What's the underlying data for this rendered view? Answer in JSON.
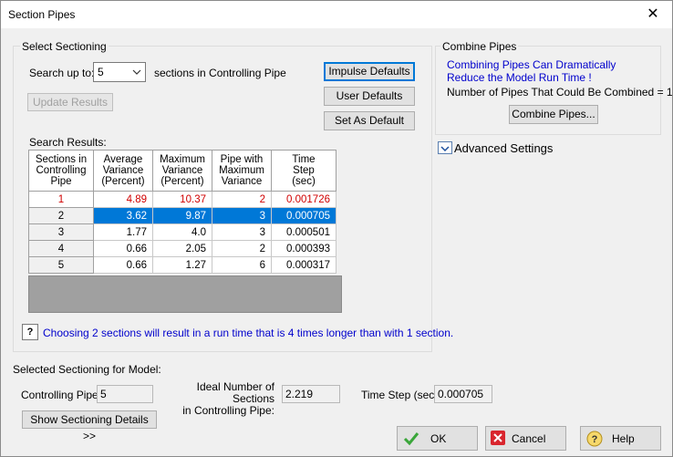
{
  "window": {
    "title": "Section Pipes",
    "close_glyph": "✕"
  },
  "select_sectioning": {
    "group_label": "Select Sectioning",
    "search_up_to_label": "Search up to:",
    "search_up_to_value": "5",
    "sections_label": "sections in Controlling Pipe",
    "update_results": "Update Results",
    "impulse_defaults": "Impulse Defaults",
    "user_defaults": "User Defaults",
    "set_as_default": "Set As Default",
    "search_results_label": "Search Results:",
    "columns": [
      [
        "Sections in",
        "Controlling",
        "Pipe"
      ],
      [
        "Average",
        "Variance",
        "(Percent)"
      ],
      [
        "Maximum",
        "Variance",
        "(Percent)"
      ],
      [
        "Pipe with",
        "Maximum",
        "Variance"
      ],
      [
        "Time",
        "Step",
        "(sec)"
      ]
    ],
    "rows": [
      [
        "1",
        "4.89",
        "10.37",
        "2",
        "0.001726"
      ],
      [
        "2",
        "3.62",
        "9.87",
        "3",
        "0.000705"
      ],
      [
        "3",
        "1.77",
        "4.0",
        "3",
        "0.000501"
      ],
      [
        "4",
        "0.66",
        "2.05",
        "2",
        "0.000393"
      ],
      [
        "5",
        "0.66",
        "1.27",
        "6",
        "0.000317"
      ]
    ],
    "help_glyph": "?",
    "info_text": "Choosing 2 sections will result in a run time that is 4 times longer than with 1 section."
  },
  "combine_pipes": {
    "group_label": "Combine Pipes",
    "warning": "Combining Pipes Can Dramatically Reduce the Model Run Time !",
    "count_text": "Number of Pipes That Could Be Combined = 1",
    "button": "Combine Pipes..."
  },
  "advanced": {
    "label": "Advanced Settings"
  },
  "selected": {
    "header": "Selected Sectioning for Model:",
    "controlling_pipe_label": "Controlling Pipe:",
    "controlling_pipe_value": "5",
    "ideal_label_line1": "Ideal Number of Sections",
    "ideal_label_line2": "in Controlling Pipe:",
    "ideal_value": "2.219",
    "time_step_label": "Time Step (sec):",
    "time_step_value": "0.000705",
    "show_details": "Show Sectioning Details >>"
  },
  "footer": {
    "ok": "OK",
    "cancel": "Cancel",
    "help": "Help"
  },
  "colors": {
    "accent": "#0078d7",
    "link_blue": "#0000cc",
    "warning_red": "#d00000"
  }
}
